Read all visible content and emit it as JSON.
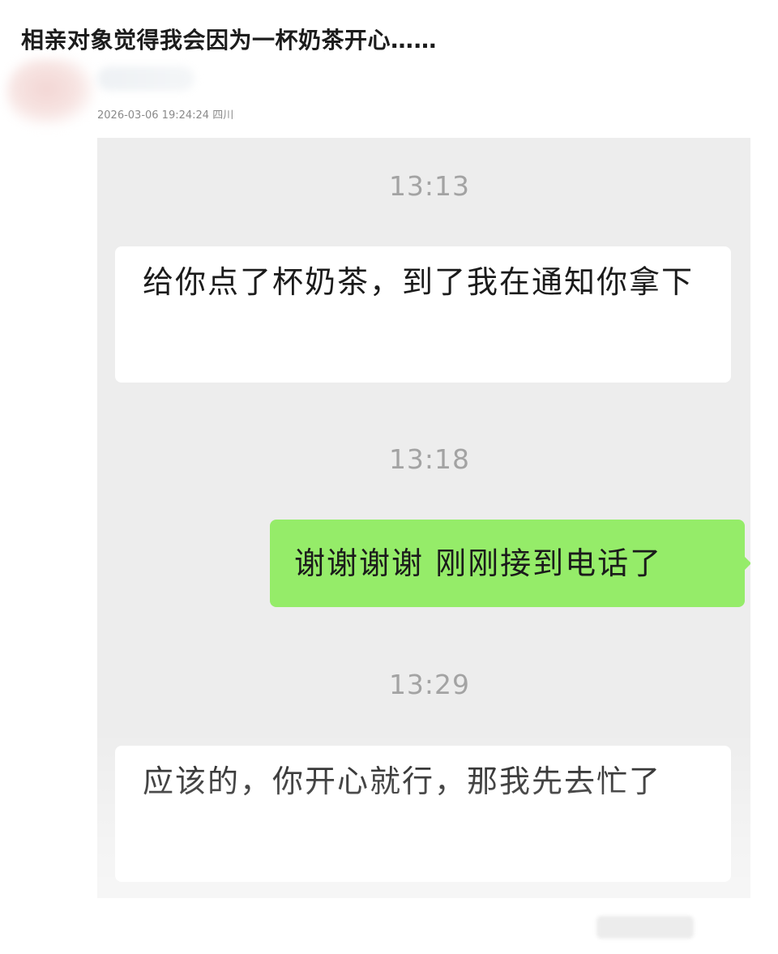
{
  "post": {
    "title": "相亲对象觉得我会因为一杯奶茶开心……",
    "meta": "2026-03-06 19:24:24 四川"
  },
  "chat": {
    "colors": {
      "background": "#ededed",
      "received_bubble": "#ffffff",
      "sent_bubble": "#95ec69"
    },
    "timestamps": [
      "13:13",
      "13:18",
      "13:29"
    ],
    "messages": [
      {
        "side": "received",
        "text": "给你点了杯奶茶，到了我在通知你拿下"
      },
      {
        "side": "sent",
        "text": "谢谢谢谢 刚刚接到电话了"
      },
      {
        "side": "received",
        "text": "应该的，你开心就行，那我先去忙了"
      }
    ]
  }
}
